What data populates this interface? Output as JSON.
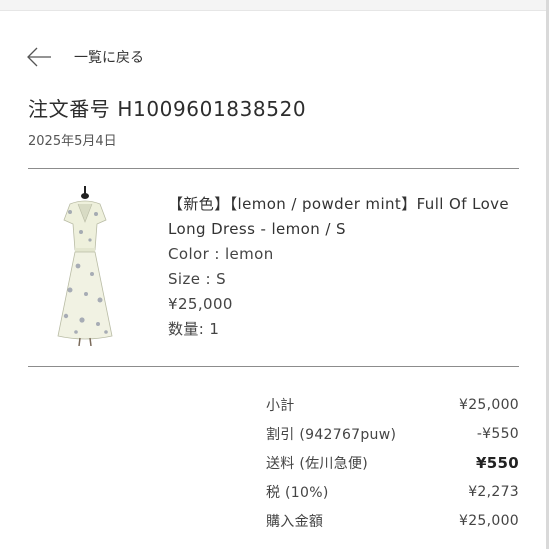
{
  "nav": {
    "back_label": "一覧に戻る"
  },
  "order": {
    "title": "注文番号 H1009601838520",
    "date": "2025年5月4日"
  },
  "item": {
    "name": "【新色】【lemon / powder mint】Full Of Love Long Dress - lemon / S",
    "color": "Color : lemon",
    "size": "Size : S",
    "price": "¥25,000",
    "quantity": "数量: 1"
  },
  "summary": {
    "rows": [
      {
        "label": "小計",
        "value": "¥25,000",
        "bold": false
      },
      {
        "label": "割引 (942767puw)",
        "value": "-¥550",
        "bold": false
      },
      {
        "label": "送料 (佐川急便)",
        "value": "¥550",
        "bold": true
      },
      {
        "label": "税 (10%)",
        "value": "¥2,273",
        "bold": false
      },
      {
        "label": "購入金額",
        "value": "¥25,000",
        "bold": false
      }
    ]
  },
  "colors": {
    "divider": "#8c8c8c",
    "text": "#333333",
    "background": "#ffffff"
  },
  "icons": {
    "back": "arrow-left-icon"
  }
}
